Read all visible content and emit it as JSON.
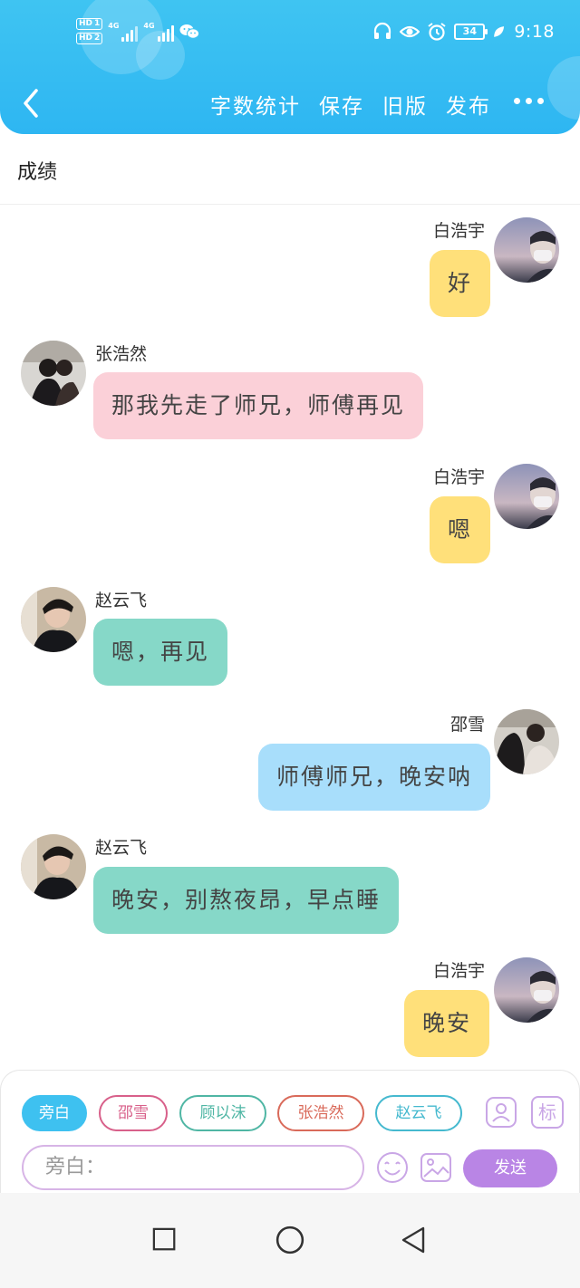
{
  "status_bar": {
    "sim1": "HD",
    "sim1_num": "1",
    "sim2": "HD",
    "sim2_num": "2",
    "net1": "4G",
    "net2": "4G",
    "battery": "34",
    "time": "9:18",
    "icons": [
      "headset-icon",
      "eye-icon",
      "alarm-icon",
      "battery-icon",
      "leaf-icon"
    ]
  },
  "header": {
    "actions": [
      {
        "label": "字数统计"
      },
      {
        "label": "保存"
      },
      {
        "label": "旧版"
      },
      {
        "label": "发布"
      }
    ],
    "accent": "#2eb6f2"
  },
  "title": "成绩",
  "messages": [
    {
      "sender": "白浩宇",
      "text": "好",
      "side": "right",
      "color": "#ffe07a"
    },
    {
      "sender": "张浩然",
      "text": "那我先走了师兄，师傅再见",
      "side": "left",
      "color": "#fbd0d8"
    },
    {
      "sender": "白浩宇",
      "text": "嗯",
      "side": "right",
      "color": "#ffe07a"
    },
    {
      "sender": "赵云飞",
      "text": "嗯，再见",
      "side": "left",
      "color": "#86d8c8"
    },
    {
      "sender": "邵雪",
      "text": "师傅师兄，晚安呐",
      "side": "right",
      "color": "#a8defb"
    },
    {
      "sender": "赵云飞",
      "text": "晚安，别熬夜昂，早点睡",
      "side": "left",
      "color": "#86d8c8"
    },
    {
      "sender": "白浩宇",
      "text": "晚安",
      "side": "right",
      "color": "#ffe07a"
    }
  ],
  "composer": {
    "chips": [
      {
        "label": "旁白",
        "selected": true,
        "color": "#3ec1f0"
      },
      {
        "label": "邵雪",
        "selected": false,
        "color": "#d8608a"
      },
      {
        "label": "顾以沫",
        "selected": false,
        "color": "#4fb6a4"
      },
      {
        "label": "张浩然",
        "selected": false,
        "color": "#d96a5a"
      },
      {
        "label": "赵云飞",
        "selected": false,
        "color": "#45b9cf"
      }
    ],
    "tool_mark_label": "标",
    "input_placeholder": "旁白：",
    "send_label": "发送"
  }
}
